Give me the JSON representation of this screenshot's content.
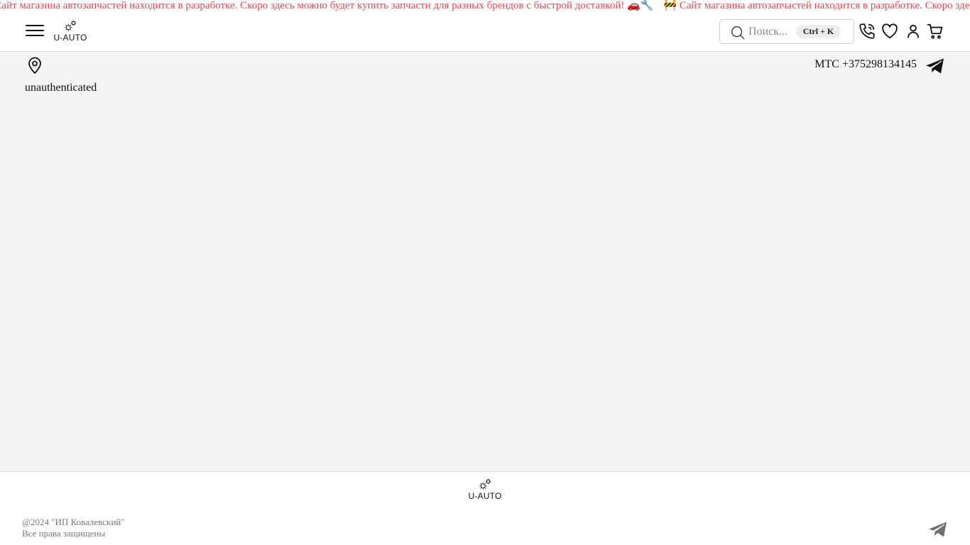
{
  "banner": {
    "text_1": "🚧 Сайт магазина автозапчастей находится в разработке. Скоро здесь можно будет купить запчасти для разных брендов с быстрой доставкой! 🚗🔧",
    "text_2": "🚧 Сайт магазина автозапчастей находится в разработке. Скоро здесь можно будет купить запчасти для разных брендов с быстрой доставкой! 🚗🔧",
    "color": "#e0484f"
  },
  "header": {
    "logo_text": "U-AUTO",
    "search_placeholder": "Поиск...",
    "search_shortcut": "Ctrl + K",
    "icons": [
      "menu-icon",
      "search-icon",
      "phone-icon",
      "heart-icon",
      "user-icon",
      "cart-icon"
    ]
  },
  "info": {
    "auth_status": "unauthenticated",
    "phone": "МТС +375298134145"
  },
  "footer": {
    "logo_text": "U-AUTO",
    "copyright": "@2024 \"ИП Ковалевский\"",
    "rights": "Все права защищены"
  }
}
